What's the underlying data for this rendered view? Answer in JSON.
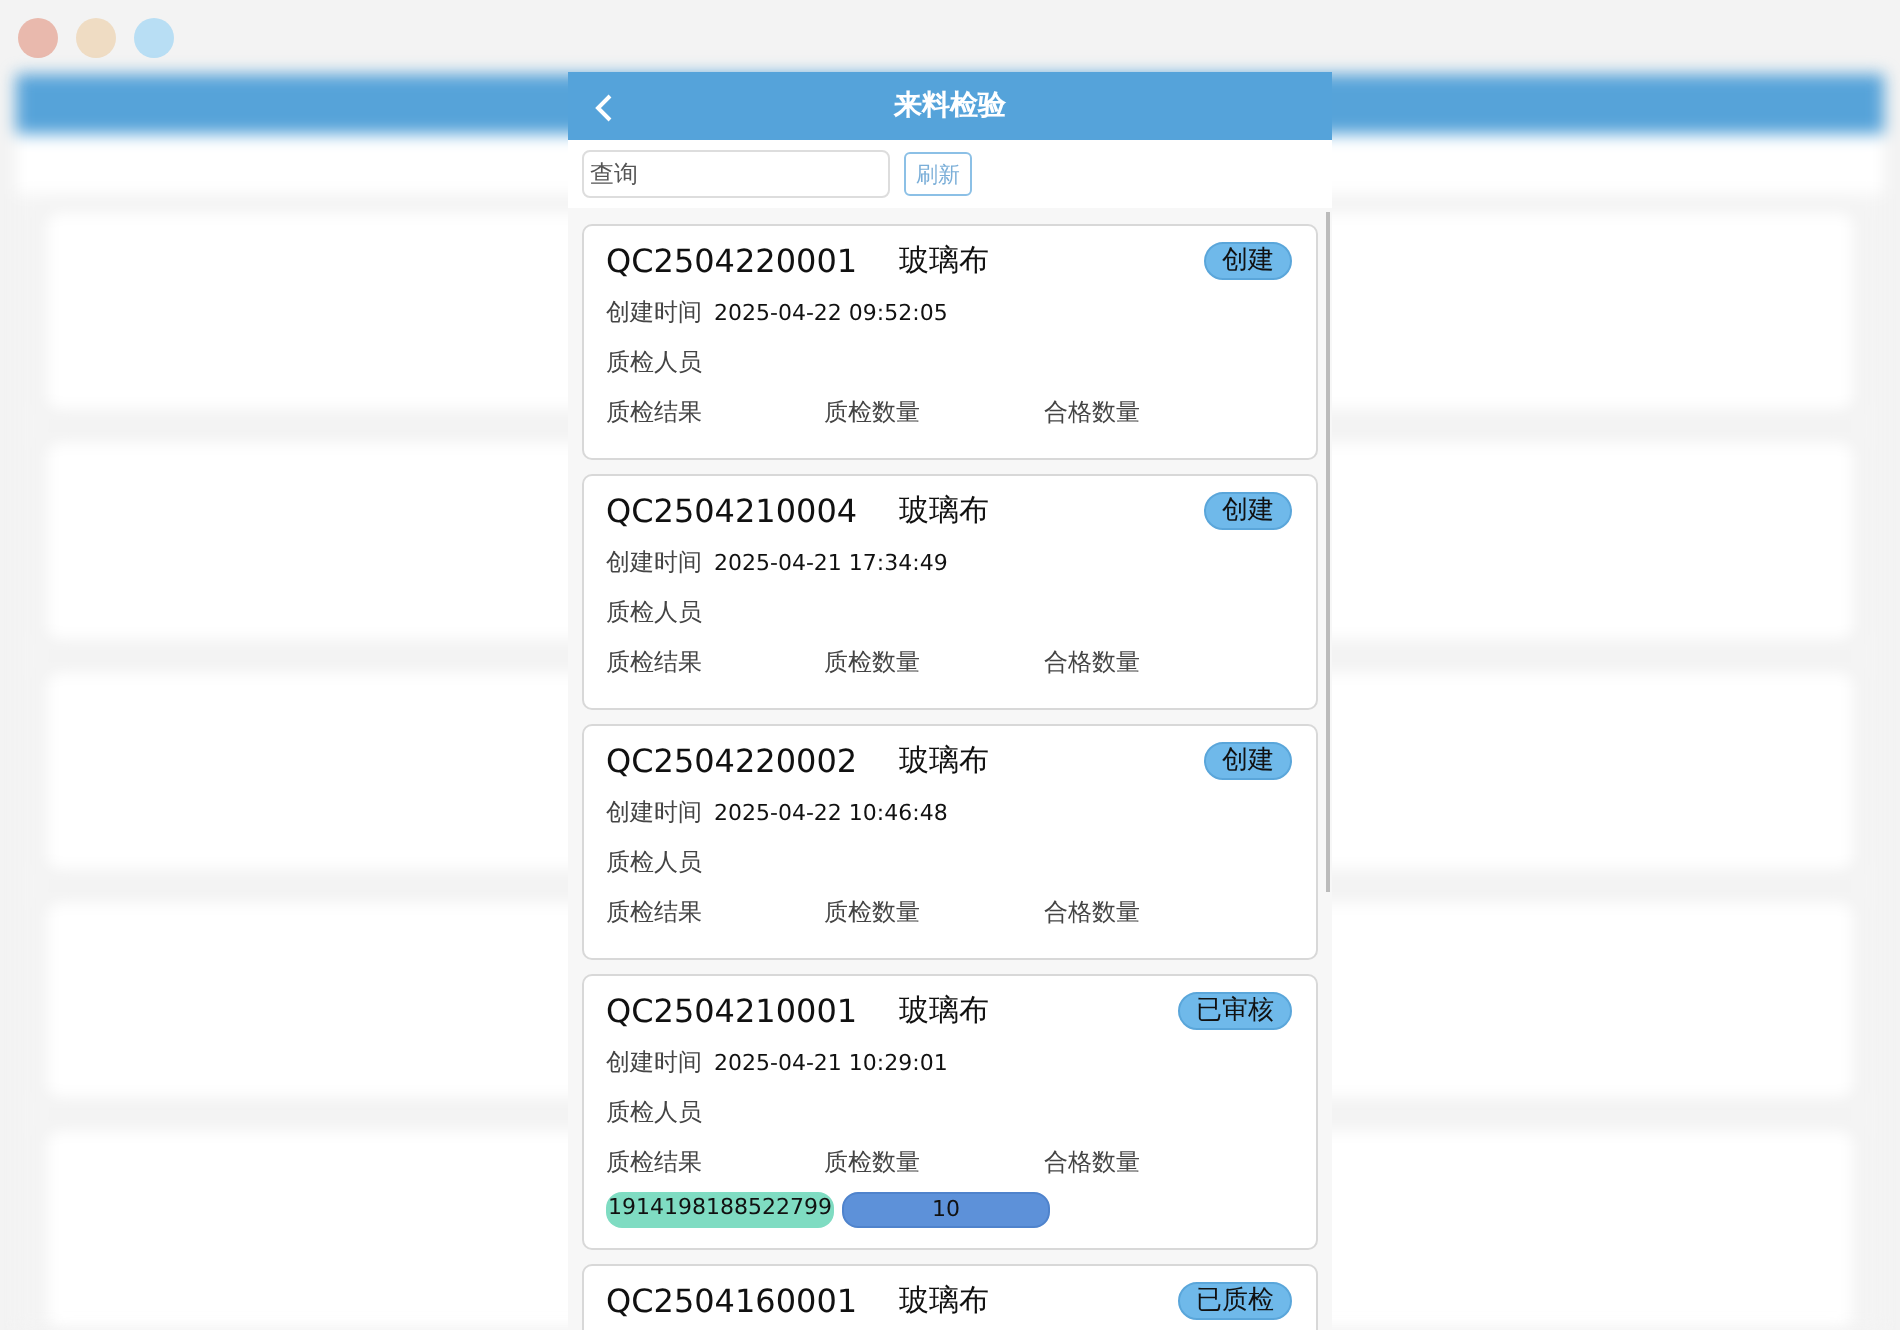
{
  "header": {
    "title": "来料检验"
  },
  "search": {
    "placeholder": "查询",
    "button": "刷新"
  },
  "records": [
    {
      "code": "QC2504220001",
      "material": "玻璃布",
      "status": "创建",
      "created_label": "创建时间",
      "created": "2025-04-22 09:52:05",
      "inspector_label": "质检人员",
      "result_label": "质检结果",
      "qty_label": "质检数量",
      "pass_label": "合格数量"
    },
    {
      "code": "QC2504210004",
      "material": "玻璃布",
      "status": "创建",
      "created_label": "创建时间",
      "created": "2025-04-21 17:34:49",
      "inspector_label": "质检人员",
      "result_label": "质检结果",
      "qty_label": "质检数量",
      "pass_label": "合格数量"
    },
    {
      "code": "QC2504220002",
      "material": "玻璃布",
      "status": "创建",
      "created_label": "创建时间",
      "created": "2025-04-22 10:46:48",
      "inspector_label": "质检人员",
      "result_label": "质检结果",
      "qty_label": "质检数量",
      "pass_label": "合格数量"
    },
    {
      "code": "QC2504210001",
      "material": "玻璃布",
      "status": "已审核",
      "created_label": "创建时间",
      "created": "2025-04-21 10:29:01",
      "inspector_label": "质检人员",
      "result_label": "质检结果",
      "qty_label": "质检数量",
      "pass_label": "合格数量",
      "result": "1914198188522799",
      "qty": "10"
    },
    {
      "code": "QC2504160001",
      "material": "玻璃布",
      "status": "已质检"
    }
  ]
}
